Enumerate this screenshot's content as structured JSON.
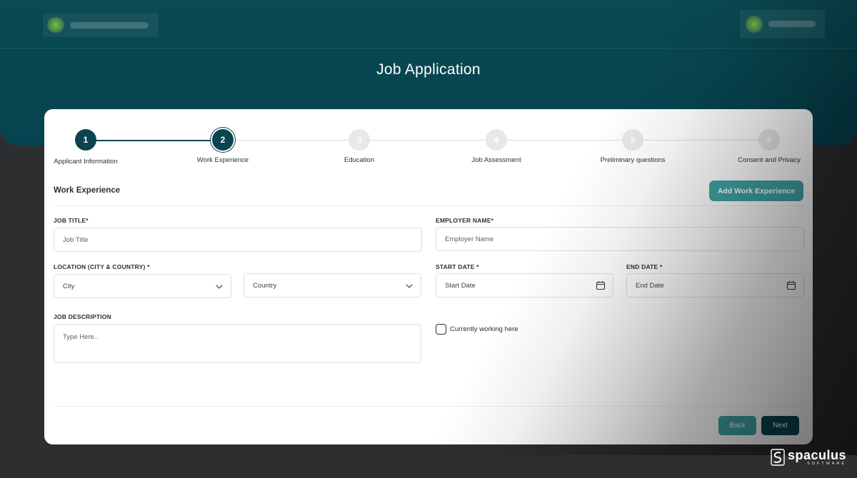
{
  "page": {
    "title": "Job Application"
  },
  "stepper": {
    "steps": [
      {
        "number": "1",
        "label": "Applicant Information",
        "state": "done"
      },
      {
        "number": "2",
        "label": "Work Experience",
        "state": "current"
      },
      {
        "number": "3",
        "label": "Education",
        "state": "pending"
      },
      {
        "number": "4",
        "label": "Job Assessment",
        "state": "pending"
      },
      {
        "number": "5",
        "label": "Preliminary questions",
        "state": "pending"
      },
      {
        "number": "6",
        "label": "Consent and Privacy",
        "state": "pending"
      }
    ]
  },
  "section": {
    "title": "Work Experience",
    "add_button": "Add Work Experience"
  },
  "form": {
    "job_title": {
      "label": "JOB TITLE*",
      "placeholder": "Job Title",
      "value": ""
    },
    "employer_name": {
      "label": "EMPLOYER NAME*",
      "placeholder": "Employer Name",
      "value": ""
    },
    "location": {
      "label": "LOCATION (CITY & COUNTRY) *",
      "city_placeholder": "City",
      "country_placeholder": "Country"
    },
    "start_date": {
      "label": "START DATE *",
      "placeholder": "Start Date"
    },
    "end_date": {
      "label": "END DATE *",
      "placeholder": "End Date"
    },
    "job_description": {
      "label": "JOB DESCRIPTION",
      "placeholder": "Type Here..",
      "value": ""
    },
    "currently_working": {
      "label": "Currently working here",
      "checked": false
    }
  },
  "footer": {
    "back": "Back",
    "next": "Next"
  },
  "brand": {
    "name": "spaculus",
    "sub": "SOFTWARE"
  },
  "colors": {
    "primary": "#0b4450",
    "accent": "#3fa4a6",
    "header_bg": "#054350"
  }
}
